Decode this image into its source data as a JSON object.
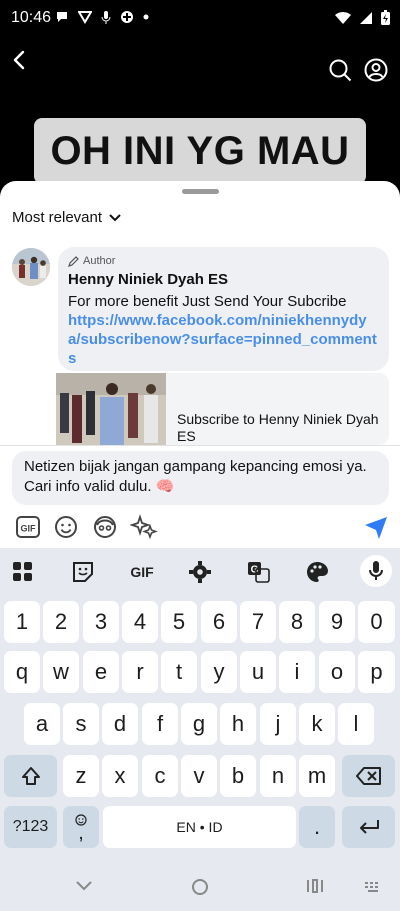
{
  "status_bar": {
    "time": "10:46"
  },
  "video": {
    "banner_text": "OH INI YG MAU"
  },
  "sort": {
    "label": "Most relevant"
  },
  "pinned_comment": {
    "author_tag": "Author",
    "author_name": "Henny Niniek Dyah ES",
    "text": "For more benefit Just Send Your Subcribe",
    "link": "https://www.facebook.com/niniekhennydya/subscribenow?surface=pinned_comments"
  },
  "link_preview": {
    "title": "Subscribe to Henny Niniek Dyah ES"
  },
  "composer": {
    "text": "Netizen bijak jangan gampang kepancing emosi ya. Cari info valid dulu. 🧠"
  },
  "composer_tools": [
    "gif-icon",
    "emoji-icon",
    "avatar-sticker-icon",
    "sparkle-sticker-icon",
    "send-icon"
  ],
  "keyboard": {
    "toolbar": [
      "apps-grid-icon",
      "sticker-icon",
      "GIF",
      "settings-icon",
      "translate-icon",
      "palette-icon",
      "mic-icon"
    ],
    "row_numbers": [
      "1",
      "2",
      "3",
      "4",
      "5",
      "6",
      "7",
      "8",
      "9",
      "0"
    ],
    "row1": [
      "q",
      "w",
      "e",
      "r",
      "t",
      "y",
      "u",
      "i",
      "o",
      "p"
    ],
    "row2": [
      "a",
      "s",
      "d",
      "f",
      "g",
      "h",
      "j",
      "k",
      "l"
    ],
    "row3": [
      "z",
      "x",
      "c",
      "v",
      "b",
      "n",
      "m"
    ],
    "symbols_label": "?123",
    "comma": ",",
    "period": ".",
    "space_label": "EN • ID"
  },
  "colors": {
    "link": "#4a8fe7",
    "send": "#2f7cf6",
    "keyboard_bg": "#e6eaf0",
    "special_key": "#cdd9e4"
  }
}
